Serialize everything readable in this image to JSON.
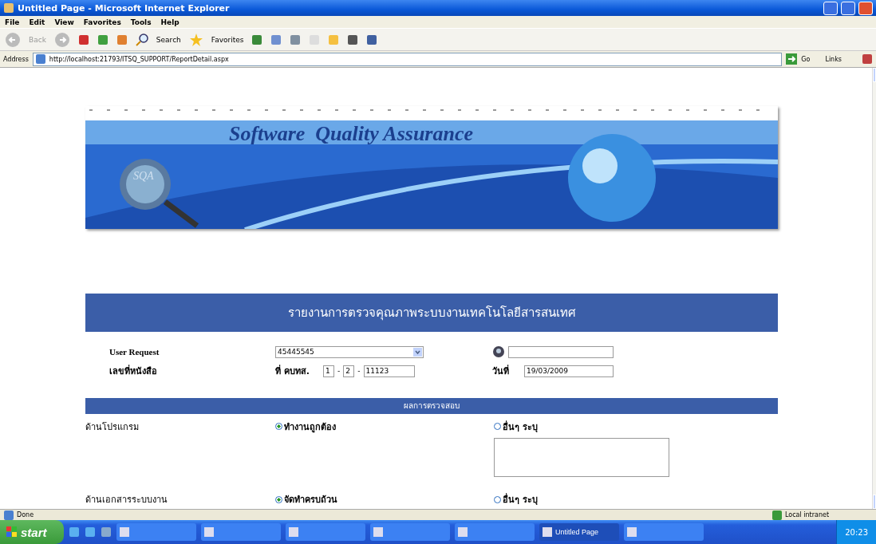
{
  "window": {
    "title": "Untitled Page - Microsoft Internet Explorer"
  },
  "menu": [
    "File",
    "Edit",
    "View",
    "Favorites",
    "Tools",
    "Help"
  ],
  "toolbar": {
    "back": "Back",
    "search": "Search",
    "favorites": "Favorites"
  },
  "address": {
    "label": "Address",
    "url": "http://localhost:21793/ITSQ_SUPPORT/ReportDetail.aspx",
    "go": "Go",
    "links": "Links"
  },
  "banner": {
    "title": "Software  Quality Assurance",
    "badge": "SQA"
  },
  "form": {
    "title": "รายงานการตรวจคุณภาพระบบงานเทคโนโลยีสารสนเทศ",
    "user_request": {
      "label": "User Request",
      "value": "45445545"
    },
    "doc_no": {
      "label": "เลขที่หนังสือ",
      "prefix": "ที่ คบทส.",
      "parts": [
        "1",
        "2",
        "11123"
      ],
      "separator": "-"
    },
    "date": {
      "label": "วันที่",
      "value": "19/03/2009"
    },
    "section": "ผลการตรวจสอบ",
    "checks": [
      {
        "label": "ด้านโปรแกรม",
        "options": [
          {
            "label": "ทำงานถูกต้อง",
            "selected": true
          },
          {
            "label": "อื่นๆ ระบุ",
            "selected": false
          }
        ],
        "has_note": true
      },
      {
        "label": "ด้านเอกสารระบบงาน",
        "options": [
          {
            "label": "จัดทำครบถ้วน",
            "selected": true
          },
          {
            "label": "อื่นๆ ระบุ",
            "selected": false
          }
        ],
        "has_note": false
      }
    ]
  },
  "status_bar": {
    "text": "Done",
    "zone": "Local intranet"
  },
  "taskbar": {
    "start": "start",
    "items": [
      {
        "active": false
      },
      {
        "active": false
      },
      {
        "active": false
      },
      {
        "active": false
      },
      {
        "active": false
      },
      {
        "label": "Untitled Page",
        "active": true
      },
      {
        "active": false
      }
    ],
    "clock": "20:23"
  }
}
